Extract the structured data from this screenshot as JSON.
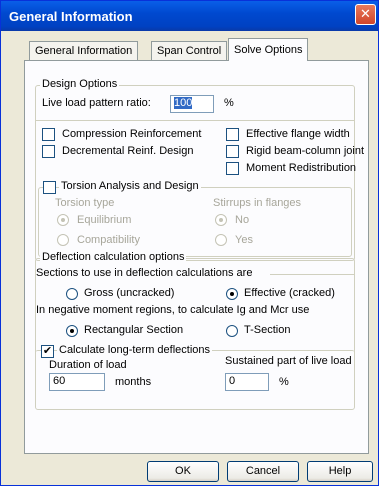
{
  "window": {
    "title": "General Information",
    "close_glyph": "✕"
  },
  "tabs": [
    {
      "label": "General Information"
    },
    {
      "label": "Span Control"
    },
    {
      "label": "Solve Options"
    }
  ],
  "design_options": {
    "legend": "Design Options",
    "live_load_label": "Live load pattern ratio:",
    "live_load_value": "100",
    "live_load_unit": "%",
    "compression_reinforcement": {
      "label": "Compression Reinforcement",
      "checked": false
    },
    "decremental_reinf": {
      "label": "Decremental Reinf. Design",
      "checked": false
    },
    "effective_flange_width": {
      "label": "Effective flange width",
      "checked": false
    },
    "rigid_beam_column_joint": {
      "label": "Rigid beam-column joint",
      "checked": false
    },
    "moment_redistribution": {
      "label": "Moment Redistribution",
      "checked": false
    },
    "torsion": {
      "label": "Torsion Analysis and Design",
      "checked": false,
      "torsion_type_label": "Torsion type",
      "equilibrium_label": "Equilibrium",
      "compatibility_label": "Compatibility",
      "stirrups_label": "Stirrups in flanges",
      "no_label": "No",
      "yes_label": "Yes"
    }
  },
  "deflection": {
    "legend": "Deflection calculation options",
    "sections_label": "Sections to use in deflection calculations are",
    "gross_label": "Gross (uncracked)",
    "effective_label": "Effective (cracked)",
    "negative_moment_label": "In negative moment regions, to calculate Ig and Mcr use",
    "rectangular_label": "Rectangular Section",
    "tsection_label": "T-Section",
    "long_term_label": "Calculate long-term deflections",
    "long_term_checked": true,
    "duration_label": "Duration of load",
    "duration_value": "60",
    "duration_unit": "months",
    "sustained_label": "Sustained part of live load",
    "sustained_value": "0",
    "sustained_unit": "%"
  },
  "buttons": {
    "ok": "OK",
    "cancel": "Cancel",
    "help": "Help"
  }
}
